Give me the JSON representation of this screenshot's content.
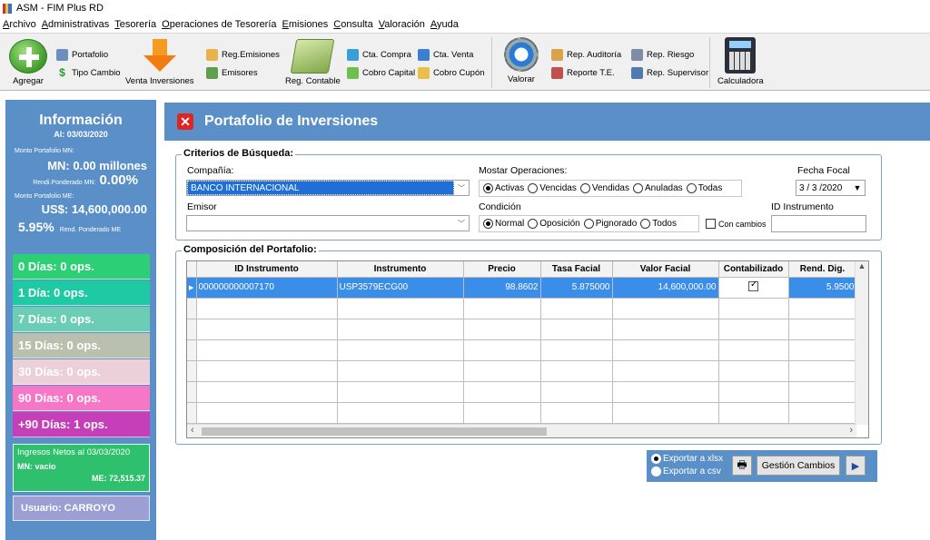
{
  "window": {
    "title": "ASM - FIM Plus RD"
  },
  "menu": [
    "Archivo",
    "Administrativas",
    "Tesorería",
    "Operaciones de Tesorería",
    "Emisiones",
    "Consulta",
    "Valoración",
    "Ayuda"
  ],
  "toolbar": {
    "agregar": "Agregar",
    "portafolio": "Portafolio",
    "tipo_cambio": "Tipo Cambio",
    "venta_inversiones": "Venta Inversiones",
    "reg_emisiones": "Reg.Emisiones",
    "emisores": "Emisores",
    "reg_contable": "Reg. Contable",
    "cta_compra": "Cta. Compra",
    "cobro_capital": "Cobro Capital",
    "cta_venta": "Cta. Venta",
    "cobro_cupon": "Cobro Cupón",
    "valorar": "Valorar",
    "rep_auditoria": "Rep. Auditoría",
    "reporte_te": "Reporte T.E.",
    "rep_riesgo": "Rep. Riesgo",
    "rep_supervisor": "Rep. Supervisor",
    "calculadora": "Calculadora"
  },
  "info": {
    "title": "Información",
    "date": "Al:  03/03/2020",
    "monto_mn_label": "Monto Portafolio MN:",
    "monto_mn": "MN: 0.00 millones",
    "rend_mn_label": "Rendi.Ponderado MN:",
    "rend_mn": "0.00%",
    "monto_me_label": "Monto Portafolio ME:",
    "monto_me": "US$: 14,600,000.00",
    "rend_me": "5.95%",
    "rend_me_label": "Rend. Ponderado ME",
    "buckets": [
      {
        "label": "0 Días: 0 ops.",
        "color": "#2dcf74"
      },
      {
        "label": "1 Día: 0 ops.",
        "color": "#1fc9a3"
      },
      {
        "label": "7 Días: 0 ops.",
        "color": "#6ccdb5"
      },
      {
        "label": "15 Días: 0 ops.",
        "color": "#b9c0ae"
      },
      {
        "label": "30 Días: 0 ops.",
        "color": "#ebcfd9"
      },
      {
        "label": "90 Días: 0 ops.",
        "color": "#f777c7"
      },
      {
        "label": "+90 Días: 1 ops.",
        "color": "#c43fb8"
      }
    ],
    "ingresos_title": "Ingresos Netos al 03/03/2020",
    "ingresos_mn": "MN: vacio",
    "ingresos_me": "ME: 72,515.37",
    "usuario": "Usuario: CARROYO"
  },
  "main": {
    "title": "Portafolio de Inversiones",
    "criterios": {
      "legend": "Criterios de Búsqueda:",
      "compania_label": "Compañía:",
      "compania_value": "BANCO INTERNACIONAL",
      "mostrar_label": "Mostar Operaciones:",
      "mostrar_options": [
        "Activas",
        "Vencidas",
        "Vendidas",
        "Anuladas",
        "Todas"
      ],
      "fecha_label": "Fecha Focal",
      "fecha_value": "3 / 3 /2020",
      "emisor_label": "Emisor",
      "emisor_value": "",
      "condicion_label": "Condición",
      "condicion_options": [
        "Normal",
        "Oposición",
        "Pignorado",
        "Todos"
      ],
      "con_cambios": "Con cambios",
      "id_instrumento_label": "ID Instrumento",
      "id_instrumento_value": ""
    },
    "composicion": {
      "legend": "Composición del Portafolio:",
      "columns": [
        "ID Instrumento",
        "Instrumento",
        "Precio",
        "Tasa Facial",
        "Valor Facial",
        "Contabilizado",
        "Rend. Dig."
      ],
      "rows": [
        {
          "id": "000000000007170",
          "instrumento": "USP3579ECG00",
          "precio": "98.8602",
          "tasa": "5.875000",
          "valor": "14,600,000.00",
          "contabilizado": true,
          "rend": "5.9500"
        }
      ]
    },
    "export": {
      "xlsx": "Exportar a xlsx",
      "csv": "Exportar a csv",
      "gestion": "Gestión Cambios"
    }
  }
}
